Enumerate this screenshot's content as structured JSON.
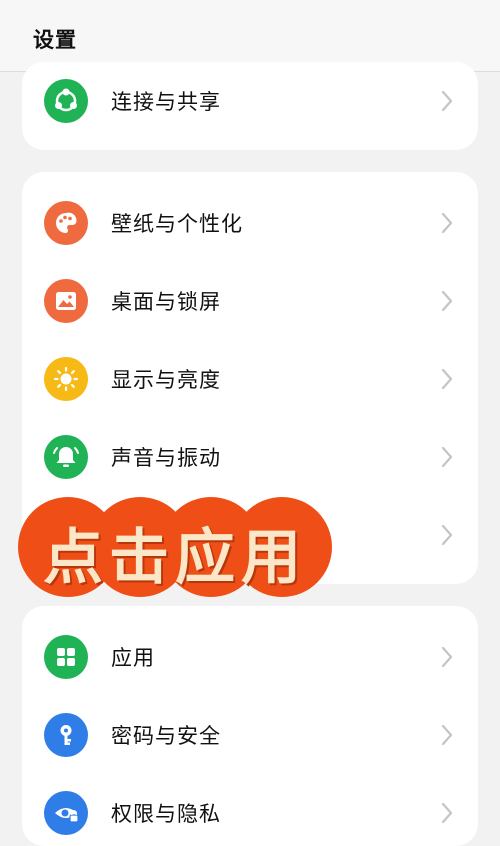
{
  "header": {
    "title": "设置"
  },
  "items": [
    {
      "label": "连接与共享",
      "icon": "share-icon",
      "color": "#20b356"
    },
    {
      "label": "壁纸与个性化",
      "icon": "palette-icon",
      "color": "#f06a3f"
    },
    {
      "label": "桌面与锁屏",
      "icon": "picture-icon",
      "color": "#f06a3f"
    },
    {
      "label": "显示与亮度",
      "icon": "sun-icon",
      "color": "#f6b915"
    },
    {
      "label": "声音与振动",
      "icon": "bell-icon",
      "color": "#20b356"
    },
    {
      "label": "应用",
      "icon": "apps-icon",
      "color": "#20b356"
    },
    {
      "label": "密码与安全",
      "icon": "key-icon",
      "color": "#2f7de6"
    },
    {
      "label": "权限与隐私",
      "icon": "privacy-eye-icon",
      "color": "#2f7de6"
    }
  ],
  "overlay": {
    "text": "点击应用",
    "color": "#ef4f17"
  }
}
